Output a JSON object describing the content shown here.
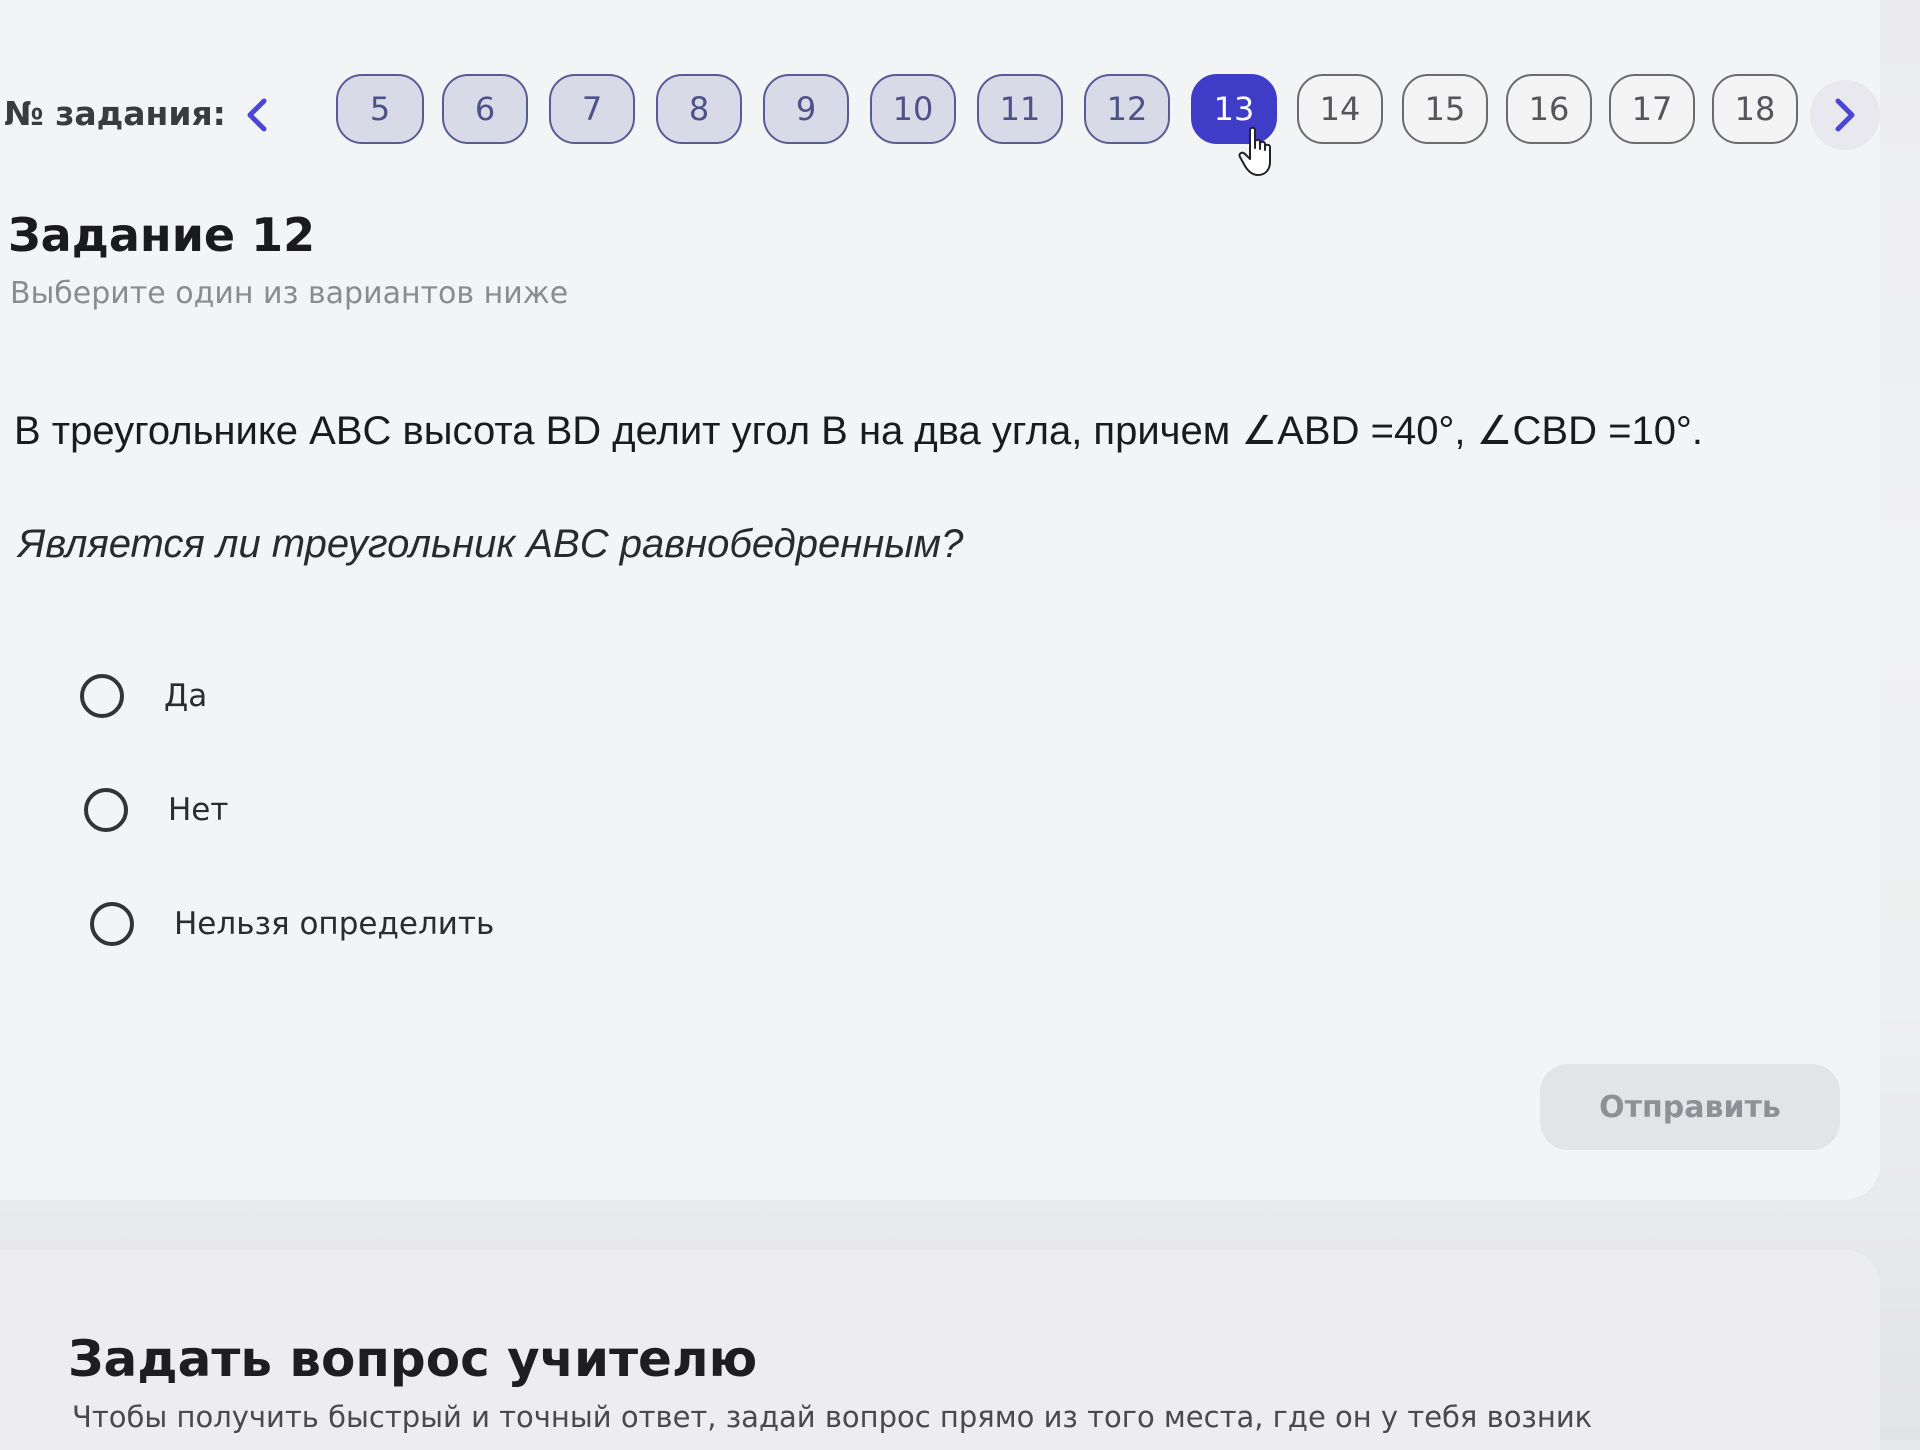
{
  "nav": {
    "label": "№ задания:",
    "prev_icon": "chevron-left-icon",
    "next_icon": "chevron-right-icon",
    "tasks": [
      {
        "label": "5",
        "state": "done"
      },
      {
        "label": "6",
        "state": "done"
      },
      {
        "label": "7",
        "state": "done"
      },
      {
        "label": "8",
        "state": "done"
      },
      {
        "label": "9",
        "state": "done"
      },
      {
        "label": "10",
        "state": "done"
      },
      {
        "label": "11",
        "state": "done"
      },
      {
        "label": "12",
        "state": "done"
      },
      {
        "label": "13",
        "state": "current"
      },
      {
        "label": "14",
        "state": "upcoming"
      },
      {
        "label": "15",
        "state": "upcoming"
      },
      {
        "label": "16",
        "state": "upcoming"
      },
      {
        "label": "17",
        "state": "upcoming"
      },
      {
        "label": "18",
        "state": "upcoming"
      }
    ]
  },
  "task": {
    "title": "Задание 12",
    "subtitle": "Выберите один из вариантов ниже",
    "question": "В треугольнике ABC высота BD делит угол B на два угла, причем ∠ABD =40°, ∠CBD =10°.",
    "prompt": "Является ли треугольник ABC равнобедренным?",
    "options": [
      "Да",
      "Нет",
      "Нельзя определить"
    ],
    "submit_label": "Отправить"
  },
  "ask_teacher": {
    "title": "Задать вопрос учителю",
    "description": "Чтобы получить быстрый и точный ответ, задай вопрос прямо из того места, где он у тебя возник"
  },
  "colors": {
    "accent": "#3f3cc8",
    "done_fill": "#d9dae8",
    "done_border": "#585c94"
  }
}
